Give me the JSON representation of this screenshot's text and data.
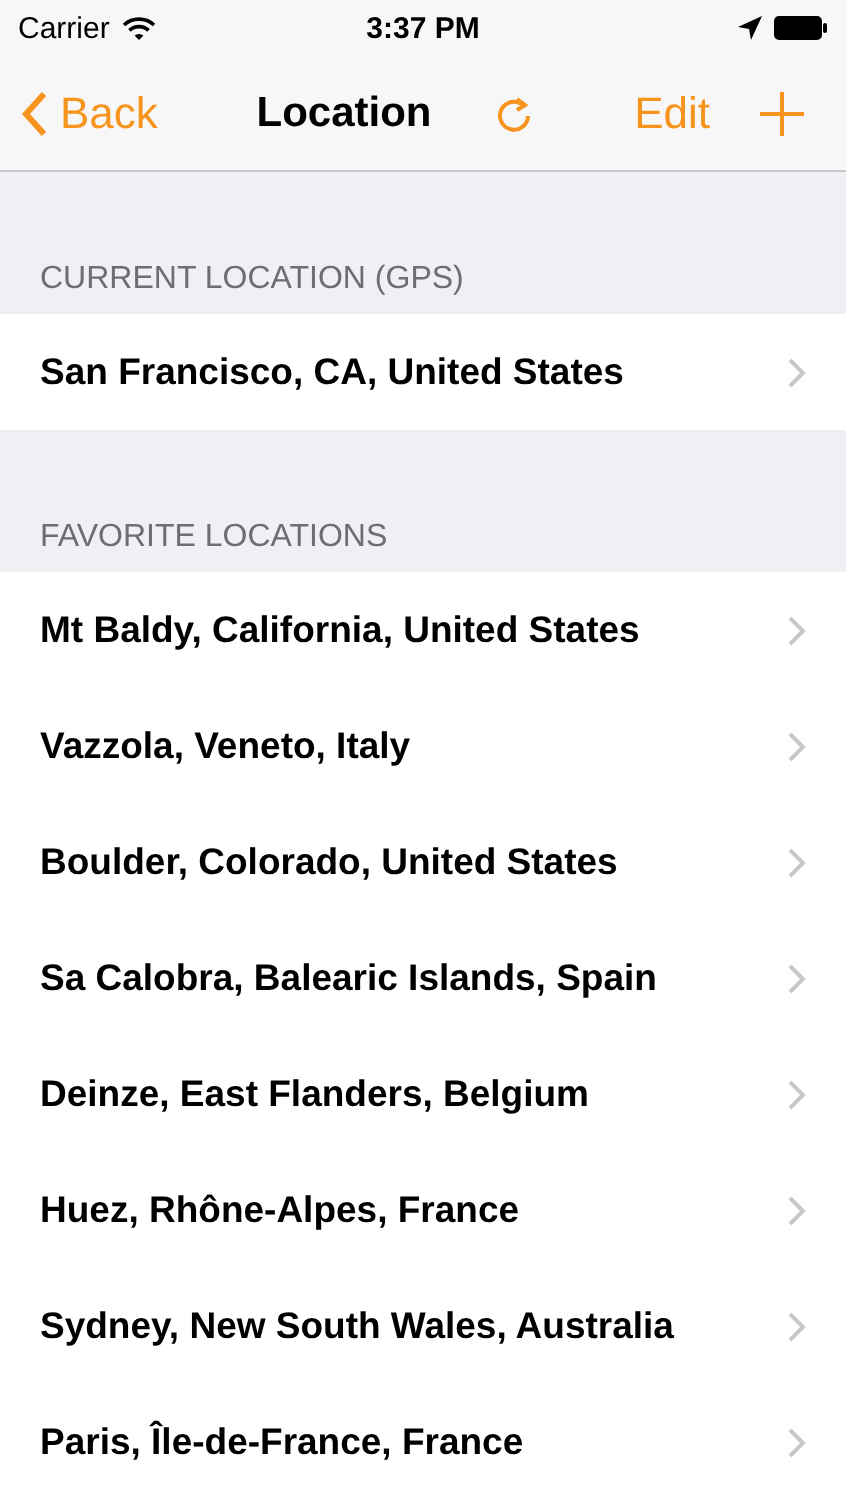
{
  "status_bar": {
    "carrier": "Carrier",
    "time": "3:37 PM"
  },
  "nav_bar": {
    "back": "Back",
    "title": "Location",
    "edit": "Edit"
  },
  "sections": [
    {
      "header": "CURRENT LOCATION (GPS)",
      "rows": [
        "San Francisco, CA, United States"
      ]
    },
    {
      "header": "FAVORITE LOCATIONS",
      "rows": [
        "Mt Baldy, California, United States",
        "Vazzola, Veneto, Italy",
        "Boulder, Colorado, United States",
        "Sa Calobra, Balearic Islands, Spain",
        "Deinze, East Flanders, Belgium",
        "Huez, Rhône-Alpes, France",
        "Sydney, New South Wales, Australia",
        "Paris, Île-de-France, France"
      ]
    }
  ]
}
